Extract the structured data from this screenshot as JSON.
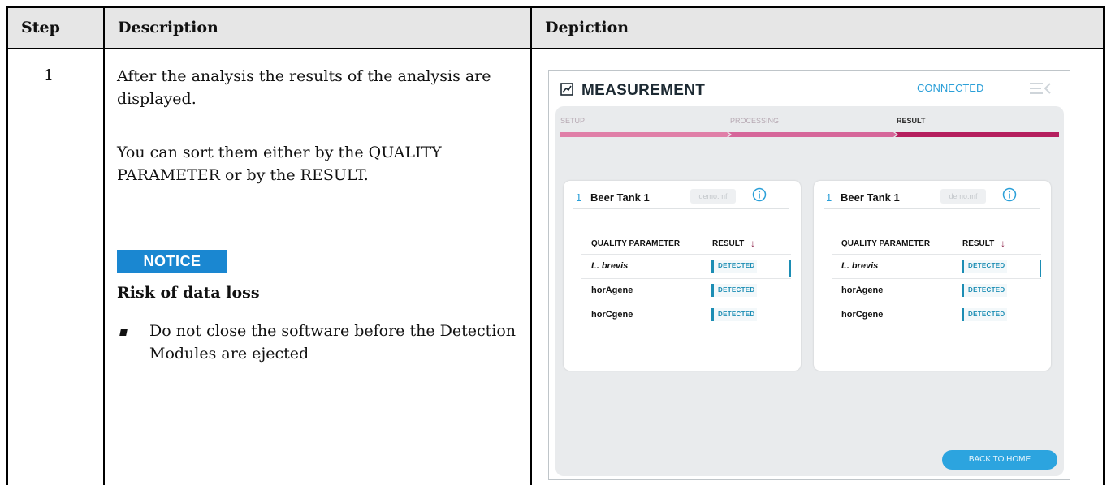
{
  "table": {
    "headers": {
      "step": "Step",
      "description": "Description",
      "depiction": "Depiction"
    },
    "row": {
      "step": "1",
      "paragraph1": "After the analysis the results of the analysis are displayed.",
      "paragraph2": "You can sort them either by the QUALITY PARAMETER or by the RESULT.",
      "notice_label": "NOTICE",
      "notice_title": "Risk of data loss",
      "notice_bullet": "Do not close the software before the Detection Modules are ejected"
    }
  },
  "screenshot": {
    "title": "MEASUREMENT",
    "status": "CONNECTED",
    "progress": {
      "steps": [
        "SETUP",
        "PROCESSING",
        "RESULT"
      ],
      "active_step": "RESULT"
    },
    "cards": [
      {
        "number": "1",
        "title": "Beer Tank 1",
        "file": "demo.mf",
        "columns": {
          "quality": "QUALITY PARAMETER",
          "result": "RESULT"
        },
        "rows": [
          {
            "parameter": "L. brevis",
            "result": "DETECTED"
          },
          {
            "parameter": "horAgene",
            "result": "DETECTED"
          },
          {
            "parameter": "horCgene",
            "result": "DETECTED"
          }
        ]
      },
      {
        "number": "1",
        "title": "Beer Tank 1",
        "file": "demo.mf",
        "columns": {
          "quality": "QUALITY PARAMETER",
          "result": "RESULT"
        },
        "rows": [
          {
            "parameter": "L. brevis",
            "result": "DETECTED"
          },
          {
            "parameter": "horAgene",
            "result": "DETECTED"
          },
          {
            "parameter": "horCgene",
            "result": "DETECTED"
          }
        ]
      }
    ],
    "back_button": "BACK TO HOME",
    "colors": {
      "accent": "#2a9fd8",
      "progress": "#c2306b",
      "badge": "#1c8db4",
      "notice": "#1a87d1"
    }
  }
}
